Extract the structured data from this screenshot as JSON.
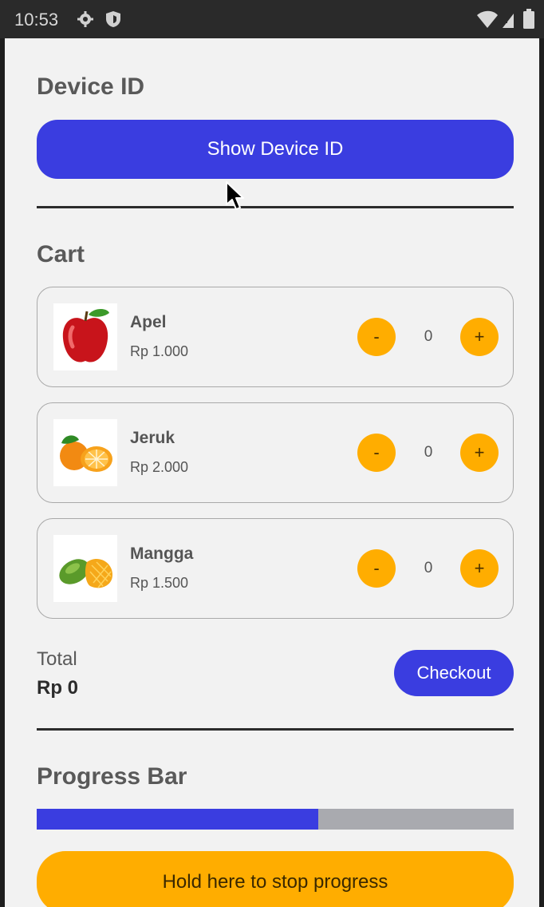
{
  "status_bar": {
    "time": "10:53",
    "icons": [
      "gear-icon",
      "shield-icon",
      "wifi-icon",
      "signal-icon",
      "battery-icon"
    ]
  },
  "device_section": {
    "title": "Device ID",
    "button_label": "Show Device ID"
  },
  "cart_section": {
    "title": "Cart",
    "items": [
      {
        "name": "Apel",
        "price": "Rp 1.000",
        "quantity": "0",
        "minus_label": "-",
        "plus_label": "+",
        "icon": "apple-icon"
      },
      {
        "name": "Jeruk",
        "price": "Rp 2.000",
        "quantity": "0",
        "minus_label": "-",
        "plus_label": "+",
        "icon": "orange-icon"
      },
      {
        "name": "Mangga",
        "price": "Rp 1.500",
        "quantity": "0",
        "minus_label": "-",
        "plus_label": "+",
        "icon": "mango-icon"
      }
    ],
    "total_label": "Total",
    "total_value": "Rp 0",
    "checkout_label": "Checkout"
  },
  "progress_section": {
    "title": "Progress Bar",
    "progress_fraction": 0.59,
    "hold_button_label": "Hold here to stop progress"
  },
  "colors": {
    "primary": "#3a3de0",
    "accent": "#ffad00",
    "background": "#f2f2f2",
    "track": "#a9aaaf"
  }
}
